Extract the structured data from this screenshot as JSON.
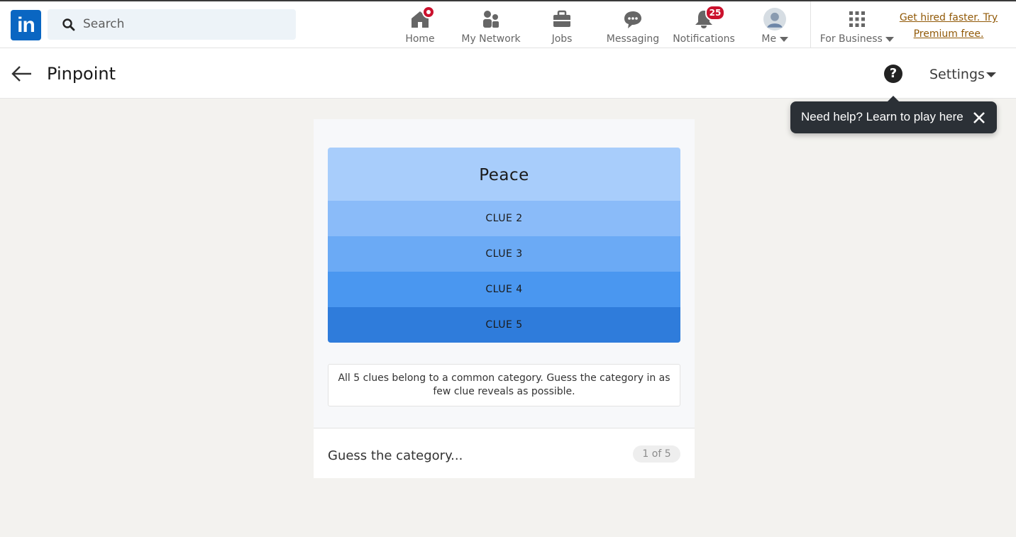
{
  "topnav": {
    "logo_text": "in",
    "search_placeholder": "Search",
    "items": [
      {
        "label": "Home",
        "icon": "home-icon"
      },
      {
        "label": "My Network",
        "icon": "network-icon"
      },
      {
        "label": "Jobs",
        "icon": "briefcase-icon"
      },
      {
        "label": "Messaging",
        "icon": "messaging-icon"
      },
      {
        "label": "Notifications",
        "icon": "bell-icon",
        "badge": "25"
      },
      {
        "label": "Me",
        "icon": "avatar"
      },
      {
        "label": "For Business",
        "icon": "grid-icon"
      }
    ],
    "premium_line1": "Get hired faster. Try",
    "premium_line2": "Premium free."
  },
  "subheader": {
    "title": "Pinpoint",
    "settings_label": "Settings",
    "help_glyph": "?"
  },
  "tooltip": {
    "text": "Need help? Learn to play here"
  },
  "game": {
    "clues": [
      "Peace",
      "CLUE 2",
      "CLUE 3",
      "CLUE 4",
      "CLUE 5"
    ],
    "hint": "All 5 clues belong to a common category. Guess the category in as few clue reveals as possible.",
    "guess_placeholder": "Guess the category...",
    "counter": "1 of 5"
  },
  "colors": {
    "brand": "#0a66c2",
    "badge": "#cb112d",
    "premium_link": "#915907",
    "clue_shades": [
      "#a8cdfb",
      "#8abbf9",
      "#6baaf5",
      "#4a97f0",
      "#2f7cdb"
    ]
  }
}
